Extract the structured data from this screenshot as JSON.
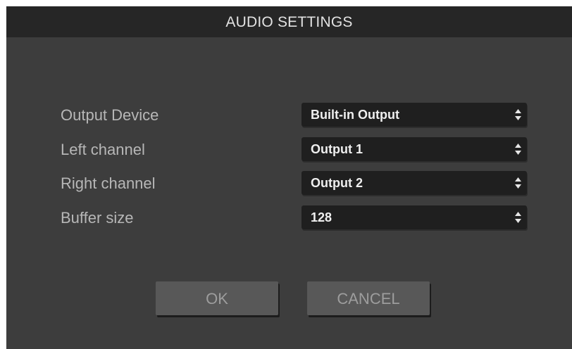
{
  "dialog": {
    "title": "AUDIO SETTINGS"
  },
  "settings": [
    {
      "label": "Output Device",
      "value": "Built-in Output"
    },
    {
      "label": "Left channel",
      "value": "Output 1"
    },
    {
      "label": "Right channel",
      "value": "Output 2"
    },
    {
      "label": "Buffer size",
      "value": "128"
    }
  ],
  "buttons": {
    "ok_label": "OK",
    "cancel_label": "CANCEL"
  },
  "icons": {
    "select_arrows": "updown-arrows-icon"
  },
  "colors": {
    "dialog_background": "#3d3d3d",
    "titlebar_background": "#262626",
    "select_background": "#1f1f1f",
    "button_background": "#585858",
    "label_text": "#b7b7b7",
    "value_text": "#efefef"
  }
}
